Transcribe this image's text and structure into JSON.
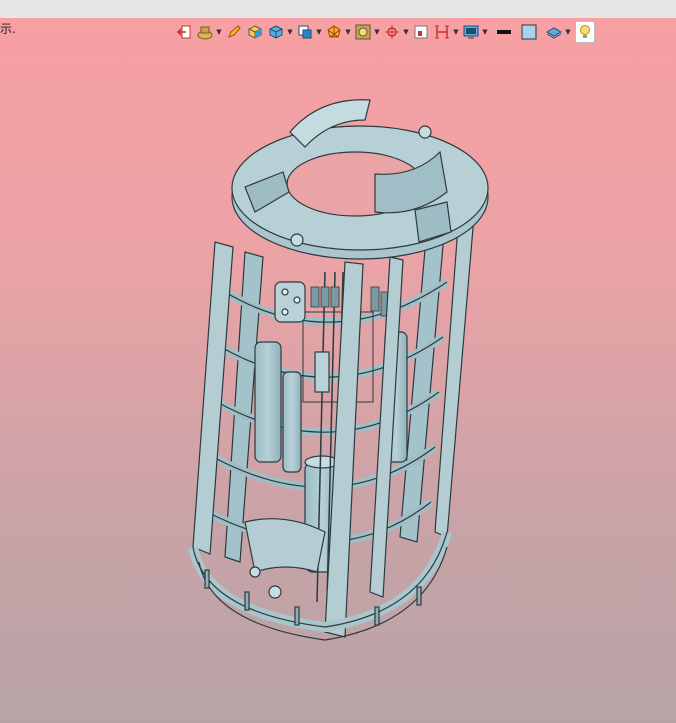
{
  "status": {
    "text": "示."
  },
  "toolbar": {
    "tools": [
      {
        "name": "exit-sketch-icon",
        "dropdown": false
      },
      {
        "name": "material-icon",
        "dropdown": true
      },
      {
        "name": "pencil-icon",
        "dropdown": false
      },
      {
        "name": "shaded-cube-icon",
        "dropdown": false
      },
      {
        "name": "view-cube-icon",
        "dropdown": true
      },
      {
        "name": "view-orientation-icon",
        "dropdown": true
      },
      {
        "name": "wireframe-icon",
        "dropdown": true
      },
      {
        "name": "render-style-icon",
        "dropdown": true
      },
      {
        "name": "origin-icon",
        "dropdown": true
      },
      {
        "name": "section-view-icon",
        "dropdown": false
      },
      {
        "name": "plane-icon",
        "dropdown": true
      },
      {
        "name": "display-mode-icon",
        "dropdown": true
      },
      {
        "name": "line-color-icon",
        "dropdown": false
      },
      {
        "name": "fill-color-icon",
        "dropdown": false
      },
      {
        "name": "layer-icon",
        "dropdown": true
      },
      {
        "name": "lightbulb-icon",
        "dropdown": false
      }
    ]
  },
  "colors": {
    "background_top": "#f8a0a3",
    "background_bottom": "#b7a3a6",
    "model_fill": "#a9c6cd",
    "model_edge": "#2c3a3e"
  }
}
